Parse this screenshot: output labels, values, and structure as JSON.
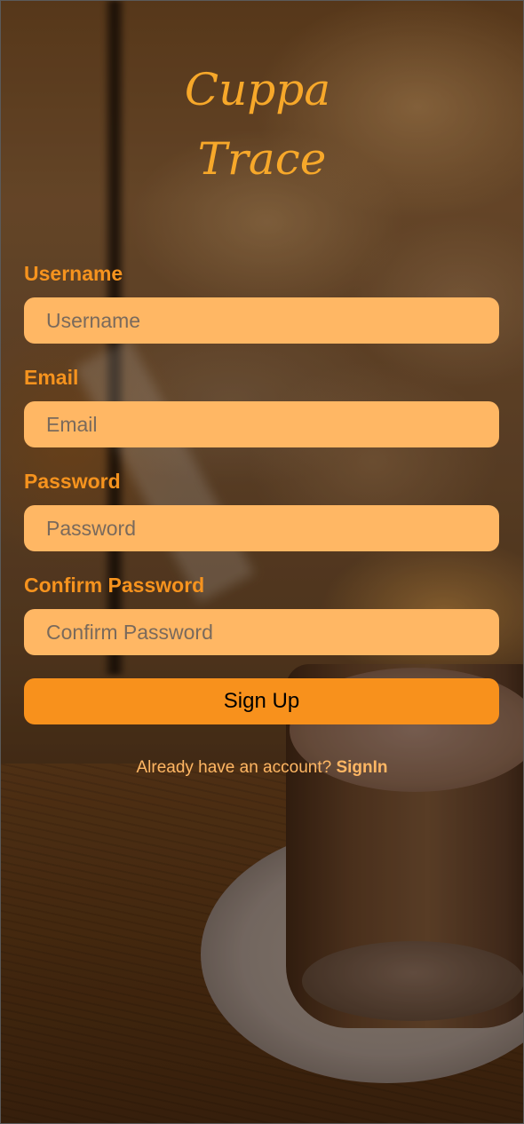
{
  "app": {
    "logo_line1": "Cuppa",
    "logo_line2": "Trace"
  },
  "form": {
    "username": {
      "label": "Username",
      "placeholder": "Username",
      "value": ""
    },
    "email": {
      "label": "Email",
      "placeholder": "Email",
      "value": ""
    },
    "password": {
      "label": "Password",
      "placeholder": "Password",
      "value": ""
    },
    "confirm_password": {
      "label": "Confirm Password",
      "placeholder": "Confirm Password",
      "value": ""
    },
    "submit_label": "Sign Up"
  },
  "footer": {
    "prompt": "Already have an account?",
    "signin_label": "SignIn"
  },
  "colors": {
    "accent": "#f6931e",
    "input_bg": "#ffb764",
    "button_bg": "#f8911c",
    "logo": "#f7a82a"
  },
  "background": {
    "subject": "coffee glass on saucer, cafe bokeh"
  }
}
